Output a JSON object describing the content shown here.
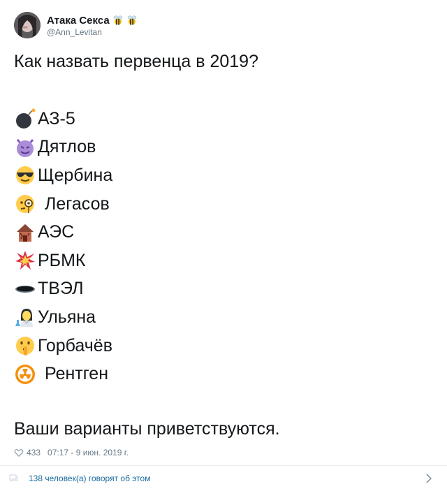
{
  "author": {
    "display_name": "Атака Секса",
    "handle": "@Ann_Levitan"
  },
  "tweet": {
    "question": "Как назвать первенца в 2019?",
    "items": [
      {
        "icon": "bomb-icon",
        "label": "АЗ-5"
      },
      {
        "icon": "devil-face-icon",
        "label": "Дятлов"
      },
      {
        "icon": "sunglasses-face-icon",
        "label": "Щербина"
      },
      {
        "icon": "monocle-face-icon",
        "label": "Легасов"
      },
      {
        "icon": "derelict-house-icon",
        "label": "АЭС"
      },
      {
        "icon": "collision-icon",
        "label": "РБМК"
      },
      {
        "icon": "hole-icon",
        "label": "ТВЭЛ"
      },
      {
        "icon": "woman-scientist-icon",
        "label": "Ульяна"
      },
      {
        "icon": "shushing-face-icon",
        "label": "Горбачёв"
      },
      {
        "icon": "radioactive-icon",
        "label": "Рентген"
      }
    ],
    "closing": "Ваши варианты приветствуются."
  },
  "meta": {
    "likes": "433",
    "timestamp": "07:17 - 9 июн. 2019 г."
  },
  "footer": {
    "talking_text": "138 человек(а) говорят об этом"
  },
  "colors": {
    "text": "#14171a",
    "secondary": "#657786",
    "link": "#1b6b9e",
    "divider": "#e6ecf0"
  }
}
